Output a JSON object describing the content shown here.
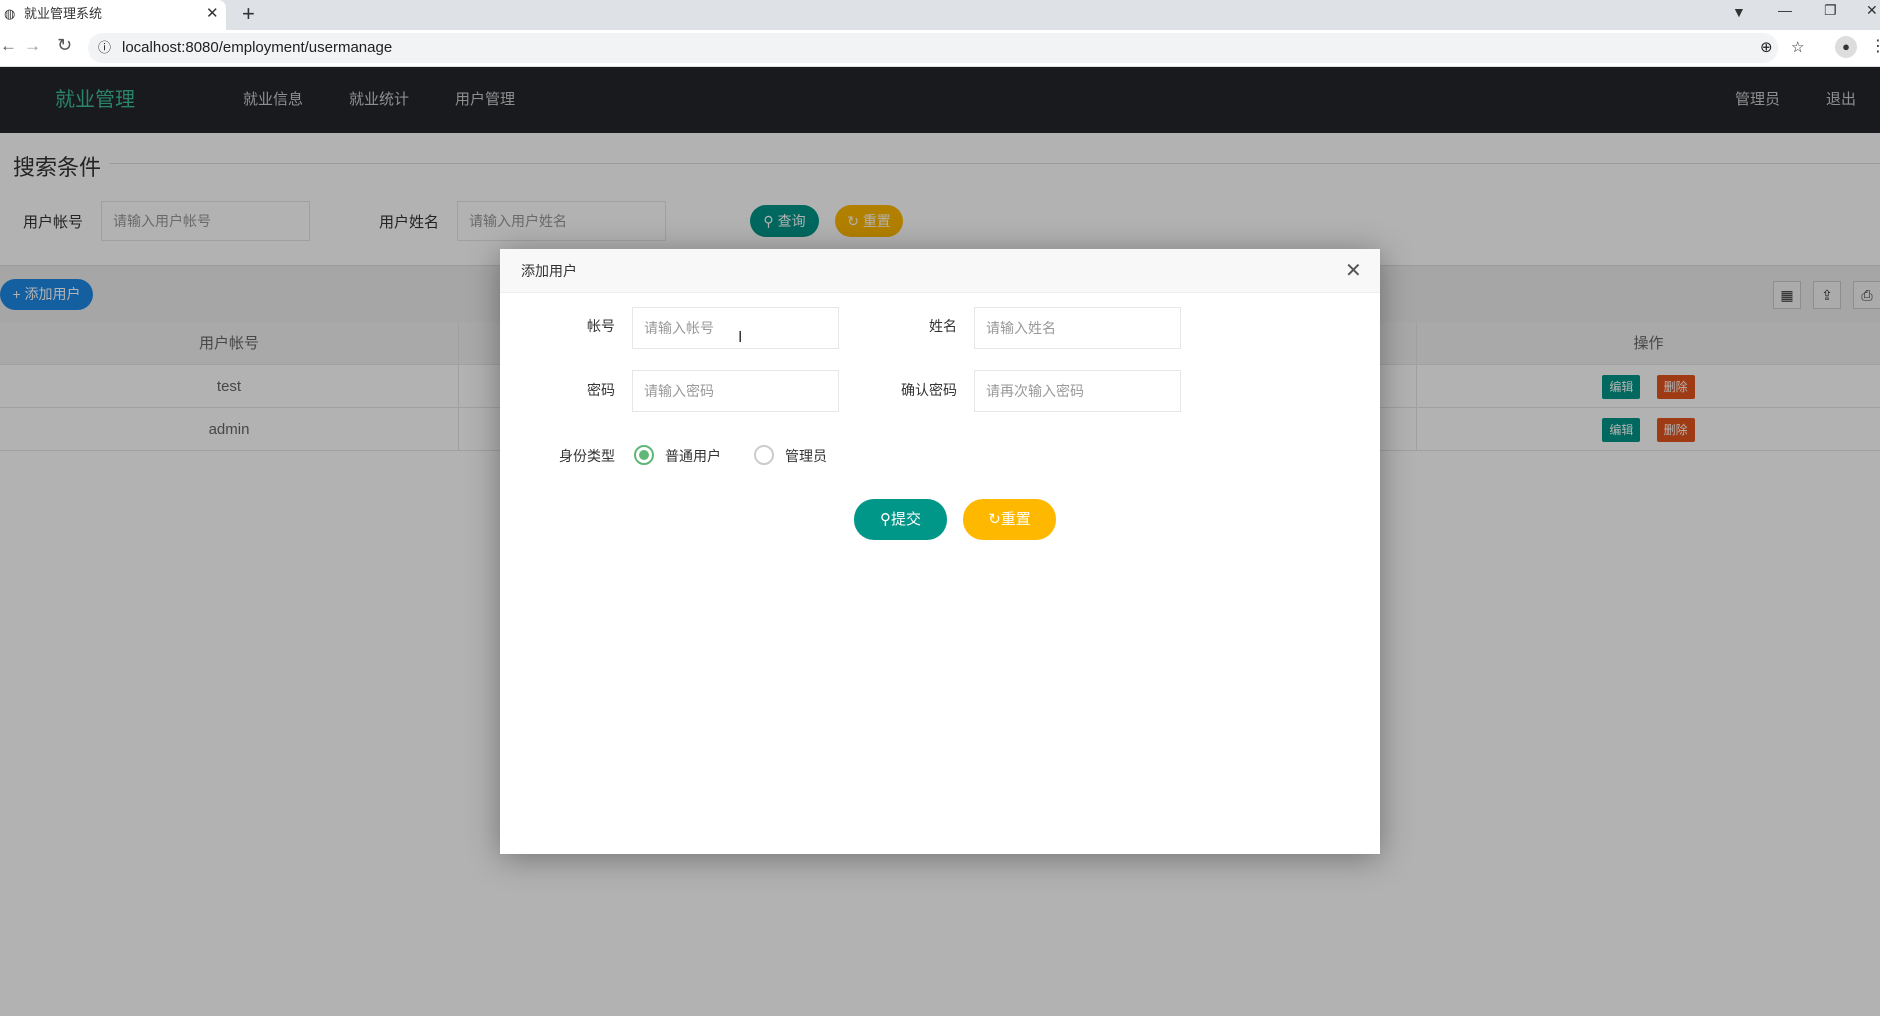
{
  "browser": {
    "tab_title": "就业管理系统",
    "url": "localhost:8080/employment/usermanage"
  },
  "nav": {
    "logo": "就业管理",
    "items": [
      "就业信息",
      "就业统计",
      "用户管理"
    ],
    "user": "管理员",
    "logout": "退出"
  },
  "search": {
    "legend": "搜索条件",
    "account_label": "用户帐号",
    "account_placeholder": "请输入用户帐号",
    "name_label": "用户姓名",
    "name_placeholder": "请输入用户姓名",
    "query": "查询",
    "reset": "重置"
  },
  "toolbar": {
    "add": "添加用户"
  },
  "table": {
    "headers": [
      "用户帐号",
      "操作"
    ],
    "rows": [
      {
        "account": "test"
      },
      {
        "account": "admin"
      }
    ],
    "edit": "编辑",
    "delete": "删除"
  },
  "modal": {
    "title": "添加用户",
    "account_label": "帐号",
    "account_placeholder": "请输入帐号",
    "name_label": "姓名",
    "name_placeholder": "请输入姓名",
    "password_label": "密码",
    "password_placeholder": "请输入密码",
    "confirm_label": "确认密码",
    "confirm_placeholder": "请再次输入密码",
    "type_label": "身份类型",
    "type_options": [
      "普通用户",
      "管理员"
    ],
    "type_selected": "普通用户",
    "submit": "提交",
    "reset": "重置"
  },
  "colors": {
    "teal": "#009688",
    "yellow": "#ffb800",
    "blue": "#1e88e5",
    "red": "#e2541e",
    "nav": "#24262b"
  }
}
